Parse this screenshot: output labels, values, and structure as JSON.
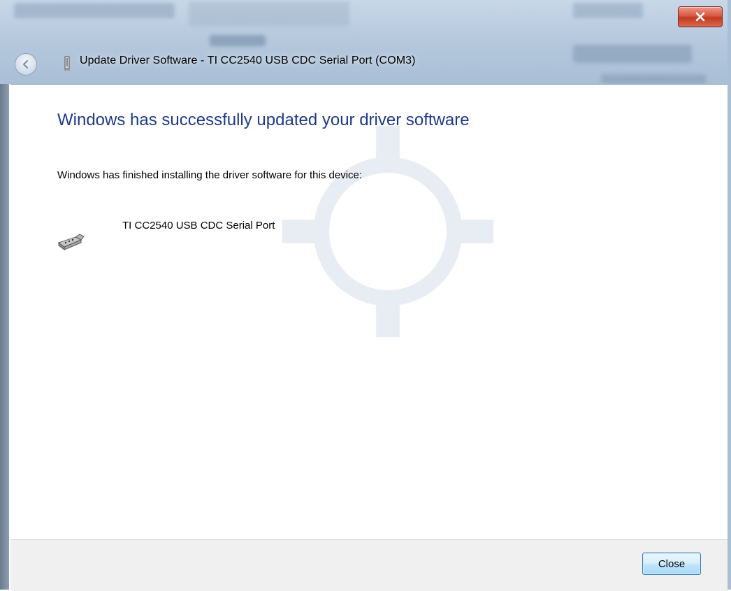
{
  "window": {
    "title": "Update Driver Software - TI CC2540 USB CDC Serial Port (COM3)",
    "close_icon": "close-x-icon",
    "back_icon": "back-arrow-icon"
  },
  "content": {
    "heading": "Windows has successfully updated your driver software",
    "subtext": "Windows has finished installing the driver software for this device:",
    "device": {
      "name": "TI CC2540 USB CDC Serial Port",
      "icon": "serial-port-icon"
    }
  },
  "footer": {
    "close_label": "Close"
  },
  "colors": {
    "heading": "#1e3a8a",
    "titlebar_close": "#c94a33"
  }
}
